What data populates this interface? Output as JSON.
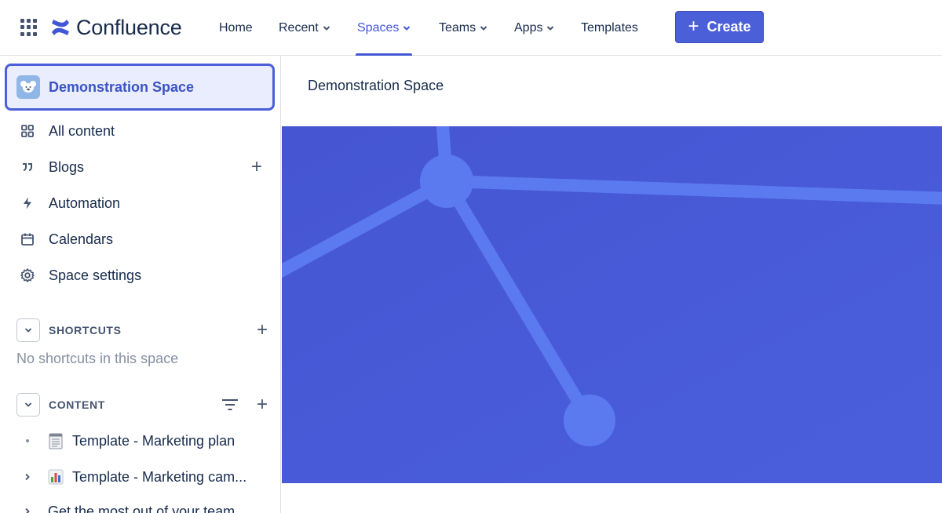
{
  "app": {
    "name": "Confluence"
  },
  "nav": {
    "home": "Home",
    "recent": "Recent",
    "spaces": "Spaces",
    "teams": "Teams",
    "apps": "Apps",
    "templates": "Templates",
    "create": "Create"
  },
  "sidebar": {
    "space_name": "Demonstration Space",
    "items": [
      {
        "label": "All content",
        "icon": "grid-icon"
      },
      {
        "label": "Blogs",
        "icon": "quote-icon"
      },
      {
        "label": "Automation",
        "icon": "lightning-icon"
      },
      {
        "label": "Calendars",
        "icon": "calendar-icon"
      },
      {
        "label": "Space settings",
        "icon": "gear-icon"
      }
    ],
    "shortcuts": {
      "title": "SHORTCUTS",
      "empty": "No shortcuts in this space"
    },
    "content": {
      "title": "CONTENT",
      "items": [
        {
          "label": "Template - Marketing plan",
          "icon": "notepad-emoji"
        },
        {
          "label": "Template - Marketing cam...",
          "icon": "bar-chart-emoji"
        },
        {
          "label": "Get the most out of your team...",
          "icon": "none"
        }
      ]
    }
  },
  "main": {
    "breadcrumb": "Demonstration Space"
  },
  "colors": {
    "accent": "#4a5fd8",
    "banner": "#4a5bd4",
    "banner_lines": "#5b7af0"
  }
}
